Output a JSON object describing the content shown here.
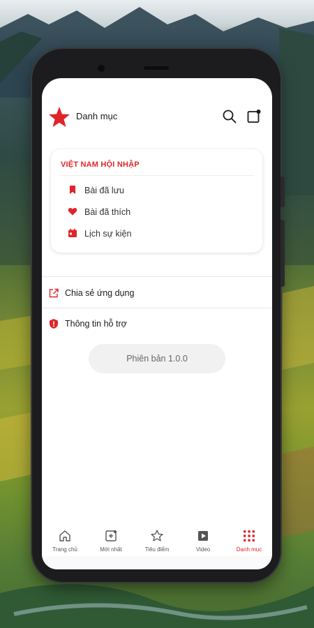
{
  "app": {
    "header": {
      "title": "Danh mục"
    },
    "card": {
      "title": "VIỆT NAM HỘI NHẬP",
      "items": [
        {
          "label": "Bài đã lưu",
          "icon": "bookmark-icon"
        },
        {
          "label": "Bài đã thích",
          "icon": "heart-icon"
        },
        {
          "label": "Lịch sự kiện",
          "icon": "calendar-icon"
        }
      ]
    },
    "menu": {
      "share": "Chia sẻ ứng dụng",
      "support": "Thông tin hỗ trợ"
    },
    "version": "Phiên bản 1.0.0",
    "tabs": [
      {
        "label": "Trang chủ",
        "icon": "home-icon"
      },
      {
        "label": "Mới nhất",
        "icon": "new-icon"
      },
      {
        "label": "Tiêu điểm",
        "icon": "star-icon"
      },
      {
        "label": "Video",
        "icon": "video-icon"
      },
      {
        "label": "Danh mục",
        "icon": "grid-icon",
        "active": true
      }
    ]
  },
  "colors": {
    "accent": "#e0242a",
    "text": "#1a1a1a"
  }
}
